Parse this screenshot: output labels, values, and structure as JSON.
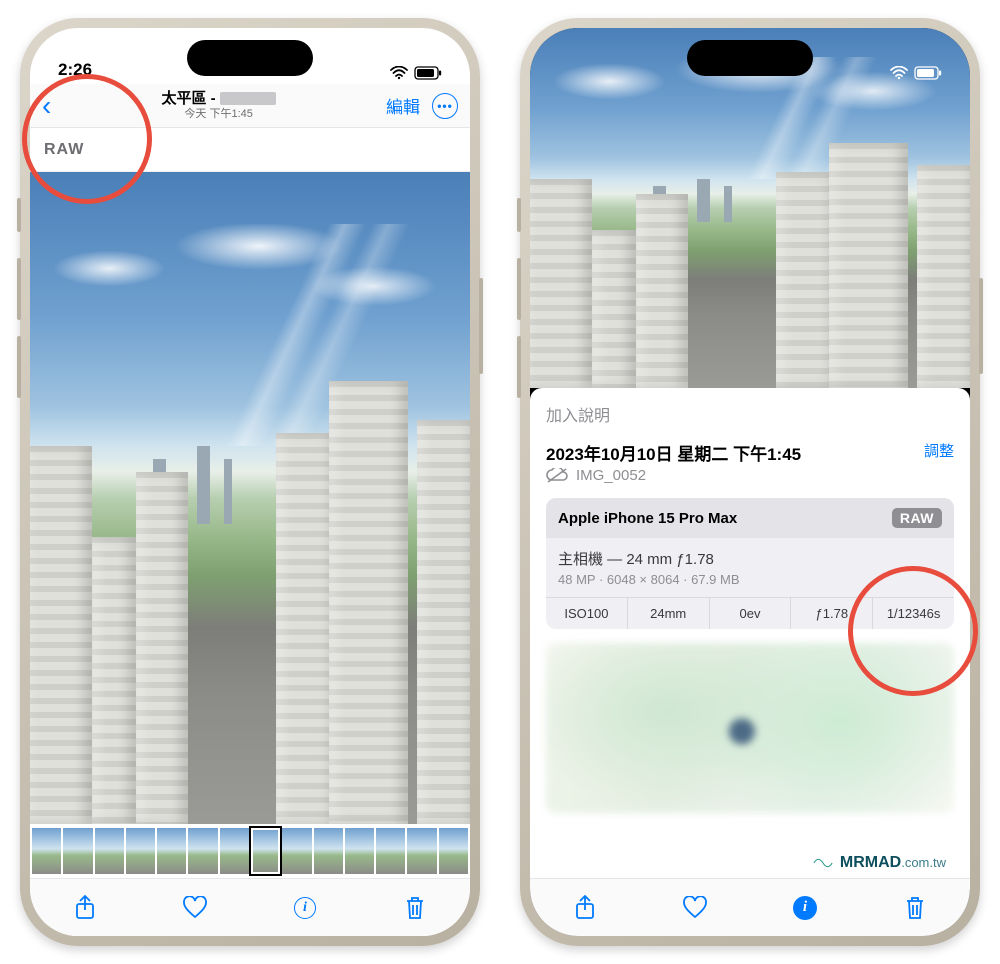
{
  "left": {
    "status_time": "2:26",
    "nav": {
      "title_prefix": "太平區 - ",
      "subtitle": "今天 下午1:45",
      "edit_label": "編輯"
    },
    "raw_badge": "RAW",
    "thumbnail_count": 14,
    "selected_thumbnail_index": 7
  },
  "right": {
    "caption_placeholder": "加入說明",
    "info": {
      "date_line": "2023年10月10日 星期二 下午1:45",
      "adjust_label": "調整",
      "filename": "IMG_0052",
      "device_model": "Apple iPhone 15 Pro Max",
      "raw_pill": "RAW",
      "lens_line": "主相機 — 24 mm ƒ1.78",
      "meta_line": "48 MP · 6048 × 8064 · 67.9 MB",
      "exif": {
        "iso": "ISO100",
        "focal": "24mm",
        "ev": "0ev",
        "aperture": "ƒ1.78",
        "shutter": "1/12346s"
      }
    }
  },
  "watermark": {
    "brand": "MRMAD",
    "tld": ".com.tw"
  },
  "colors": {
    "accent": "#e74c3c",
    "ios_blue": "#007aff"
  }
}
